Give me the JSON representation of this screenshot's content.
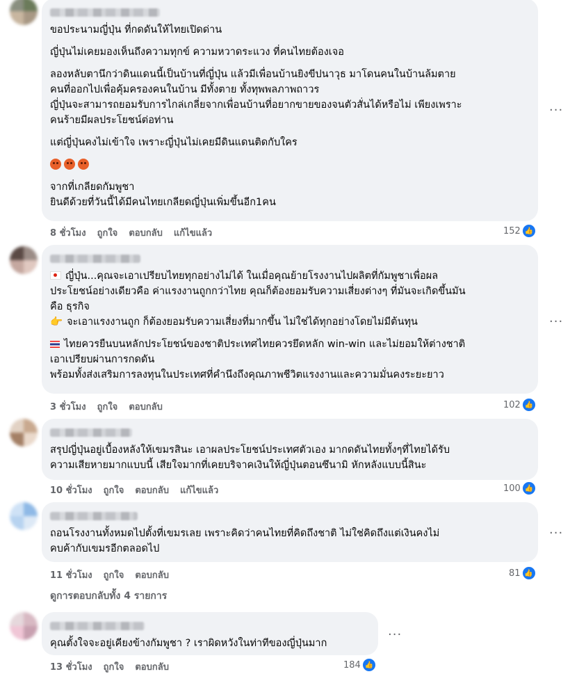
{
  "comments": [
    {
      "lines": [
        "ขอประนามญี่ปุ่น ที่กดดันให้ไทยเปิดด่าน",
        "",
        "ญี่ปุ่นไม่เคยมองเห็นถึงความทุกข์ ความหวาดระแวง ที่คนไทยต้องเจอ",
        "",
        "ลองหลับตานึกว่าดินแดนนี้เป็นบ้านที่ญี่ปุ่น แล้วมีเพื่อนบ้านยิงขีปนาวุธ มาโดนคนในบ้านล้มตาย",
        "คนที่ออกไปเพื่อคุ้มครองคนในบ้าน มีทั้งตาย ทั้งทุพพลภาพถาวร",
        "ญี่ปุ่นจะสามารถยอมรับการไกล่เกลี่ยจากเพื่อนบ้านที่อยากขายของจนตัวสั่นได้หรือไม่ เพียงเพราะ",
        "คนร้ายมีผลประโยชน์ต่อท่าน",
        "",
        "แต่ญี่ปุ่นคงไม่เข้าใจ เพราะญี่ปุ่นไม่เคยมีดินแดนติดกับใคร"
      ],
      "lines_after_emoji": [
        "จากที่เกลียดกัมพูชา",
        "ยินดีด้วยที่วันนี้ได้มีคนไทยเกลียดญี่ปุ่นเพิ่มขึ้นอีก1คน"
      ],
      "time": "8 ชั่วโมง",
      "like": "ถูกใจ",
      "reply": "ตอบกลับ",
      "edited": "แก้ไขแล้ว",
      "reactions": "152"
    },
    {
      "line1": "ญี่ปุ่น...คุณจะเอาเปรียบไทยทุกอย่างไม่ได้ ในเมื่อคุณย้ายโรงงานไปผลิตที่กัมพูชาเพื่อผล",
      "line2": "ประโยชน์อย่างเดียวคือ ค่าแรงงานถูกกว่าไทย คุณก็ต้องยอมรับความเสี่ยงต่างๆ ที่มันจะเกิดขึ้นมัน",
      "line3": "คือ ธุรกิจ",
      "line4": "จะเอาแรงงานถูก ก็ต้องยอมรับความเสี่ยงที่มากขึ้น ไม่ใช่ได้ทุกอย่างโดยไม่มีต้นทุน",
      "line5": "ไทยควรยืนบนหลักประโยชน์ของชาติประเทศไทยควรยึดหลัก win-win และไม่ยอมให้ต่างชาติ",
      "line6": "เอาเปรียบผ่านการกดดัน",
      "line7": "พร้อมทั้งส่งเสริมการลงทุนในประเทศที่คำนึงถึงคุณภาพชีวิตแรงงานและความมั่นคงระยะยาว",
      "time": "3 ชั่วโมง",
      "like": "ถูกใจ",
      "reply": "ตอบกลับ",
      "reactions": "102"
    },
    {
      "line1": "สรุปญี่ปุ่นอยู่เบื้องหลังให้เขมรสินะ เอาผลประโยชน์ประเทศตัวเอง มากดดันไทยทั้งๆที่ไทยได้รับ",
      "line2": "ความเสียหายมากแบบนี้ เสียใจมากที่เคยบริจาคเงินให้ญี่ปุ่นตอนซึนามิ หักหลังแบบนี้สินะ",
      "time": "10 ชั่วโมง",
      "like": "ถูกใจ",
      "reply": "ตอบกลับ",
      "edited": "แก้ไขแล้ว",
      "reactions": "100"
    },
    {
      "line1": "ถอนโรงงานทั้งหมดไปตั้งที่เขมรเลย เพราะคิดว่าคนไทยที่คิดถึงชาติ ไม่ใช่คิดถึงแต่เงินคงไม่",
      "line2": "คบค้ากับเขมรอีกตลอดไป",
      "time": "11 ชั่วโมง",
      "like": "ถูกใจ",
      "reply": "ตอบกลับ",
      "reactions": "81"
    },
    {
      "line1": "คุณตั้งใจจะอยู่เคียงข้างกัมพูชา ? เราผิดหวังในท่าทีของญี่ปุ่นมาก",
      "time": "13 ชั่วโมง",
      "like": "ถูกใจ",
      "reply": "ตอบกลับ",
      "reactions": "184"
    }
  ],
  "view_replies": "ดูการตอบกลับทั้ง 4 รายการ",
  "more_label": "···",
  "like_glyph": "👍"
}
